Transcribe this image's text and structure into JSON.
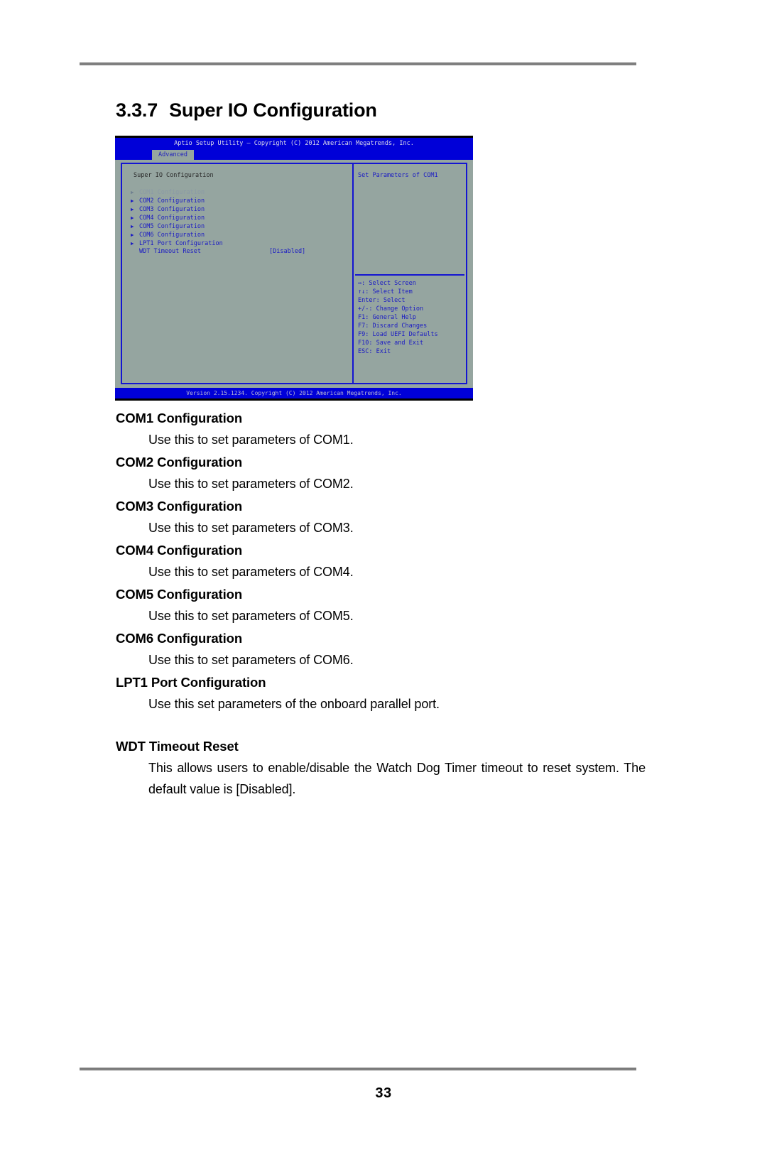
{
  "document": {
    "page_number": "33",
    "section_number": "3.3.7",
    "section_title": "Super IO Configuration"
  },
  "bios": {
    "title": "Aptio Setup Utility – Copyright (C) 2012 American Megatrends, Inc.",
    "tab": "Advanced",
    "screen_title": "Super IO Configuration",
    "menu_items": [
      {
        "label": "COM1 Configuration",
        "selected": true
      },
      {
        "label": "COM2 Configuration",
        "selected": false
      },
      {
        "label": "COM3 Configuration",
        "selected": false
      },
      {
        "label": "COM4 Configuration",
        "selected": false
      },
      {
        "label": "COM5 Configuration",
        "selected": false
      },
      {
        "label": "COM6 Configuration",
        "selected": false
      },
      {
        "label": "LPT1 Port Configuration",
        "selected": false
      }
    ],
    "setting": {
      "label": "WDT Timeout Reset",
      "value": "[Disabled]"
    },
    "help_text": "Set Parameters of COM1",
    "key_legend": [
      "↔: Select Screen",
      "↑↓: Select Item",
      "Enter: Select",
      "+/-: Change Option",
      "F1: General Help",
      "F7: Discard Changes",
      "F9: Load UEFI Defaults",
      "F10: Save and Exit",
      "ESC: Exit"
    ],
    "footer": "Version 2.15.1234. Copyright (C) 2012 American Megatrends, Inc.",
    "colors": {
      "title_bar": "#0000d8",
      "panel_bg": "#95a5a0",
      "border": "#1414d2",
      "text": "#1a1ac4"
    }
  },
  "entries": [
    {
      "term": "COM1 Configuration",
      "desc": "Use this to set parameters of COM1."
    },
    {
      "term": "COM2 Configuration",
      "desc": "Use this to set parameters of COM2."
    },
    {
      "term": "COM3 Configuration",
      "desc": "Use this to set parameters of COM3."
    },
    {
      "term": "COM4 Configuration",
      "desc": "Use this to set parameters of COM4."
    },
    {
      "term": "COM5 Configuration",
      "desc": "Use this to set parameters of COM5."
    },
    {
      "term": "COM6 Configuration",
      "desc": "Use this to set parameters of COM6."
    },
    {
      "term": "LPT1 Port Configuration",
      "desc": "Use this set parameters of the onboard parallel port."
    },
    {
      "term": "WDT Timeout Reset",
      "desc": "This allows users to enable/disable the Watch Dog Timer timeout to reset system. The default value is [Disabled]."
    }
  ]
}
